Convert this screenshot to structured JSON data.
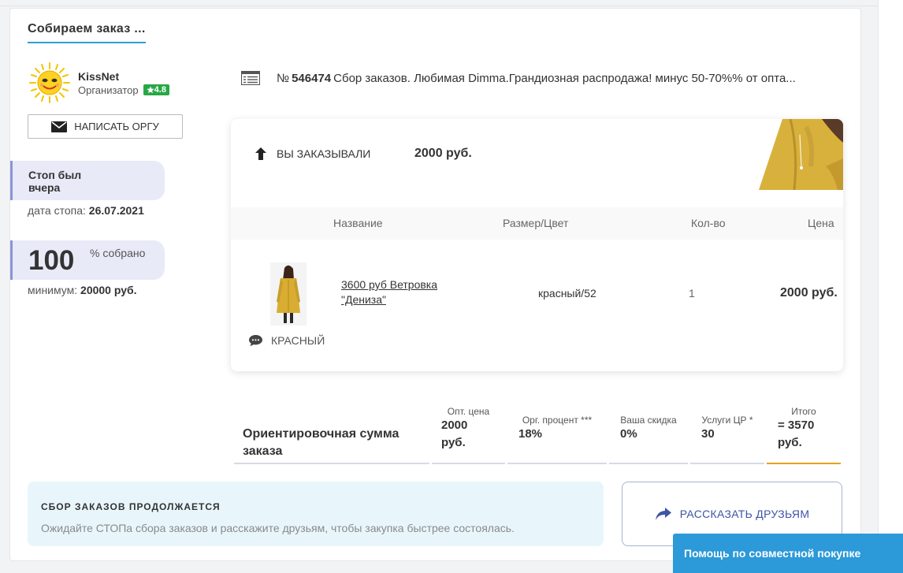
{
  "heading": "Собираем заказ ...",
  "organizer": {
    "name": "KissNet",
    "role": "Организатор",
    "rating": "4.8",
    "write_button": "НАПИСАТЬ ОРГУ"
  },
  "stop": {
    "status": "Стоп был вчера",
    "date_label": "дата стопа:",
    "date_value": "26.07.2021"
  },
  "progress": {
    "value": "100",
    "unit": "% собрано",
    "min_label": "минимум:",
    "min_value": "20000 руб."
  },
  "order": {
    "number_prefix": "№",
    "number": "546474",
    "title": "Сбор заказов. Любимая Dimma.Грандиозная распродажа! минус 50-70%% от опта..."
  },
  "ordered": {
    "label": "ВЫ ЗАКАЗЫВАЛИ",
    "sum": "2000 руб."
  },
  "table": {
    "headers": {
      "name": "Название",
      "size": "Размер/Цвет",
      "qty": "Кол-во",
      "price": "Цена"
    },
    "row": {
      "name": "3600 руб Ветровка \"Дениза\"",
      "size": "красный/52",
      "qty": "1",
      "price": "2000 руб.",
      "comment": "КРАСНЫЙ"
    }
  },
  "summary": {
    "label": "Ориентировочная сумма заказа",
    "opt_caption": "Опт. цена",
    "opt_value": "2000 руб.",
    "org_caption": "Орг. процент ***",
    "org_value": "18%",
    "discount_caption": "Ваша скидка",
    "discount_value": "0%",
    "services_caption": "Услуги ЦР *",
    "services_value": "30",
    "total_caption": "Итого",
    "total_value": "= 3570 руб."
  },
  "notice": {
    "title": "СБОР ЗАКАЗОВ ПРОДОЛЖАЕТСЯ",
    "text": "Ожидайте СТОПа сбора заказов и расскажите друзьям, чтобы закупка быстрее состоялась."
  },
  "share_button": "РАССКАЗАТЬ ДРУЗЬЯМ",
  "help_button": "Помощь по совместной покупке",
  "colors": {
    "accent": "#2a9fd8",
    "rating_green": "#27a844",
    "pill_bg": "#e8eaf7",
    "pill_border": "#8d93d6",
    "total_underline": "#e8a21a",
    "share_text": "#3e54a5"
  }
}
